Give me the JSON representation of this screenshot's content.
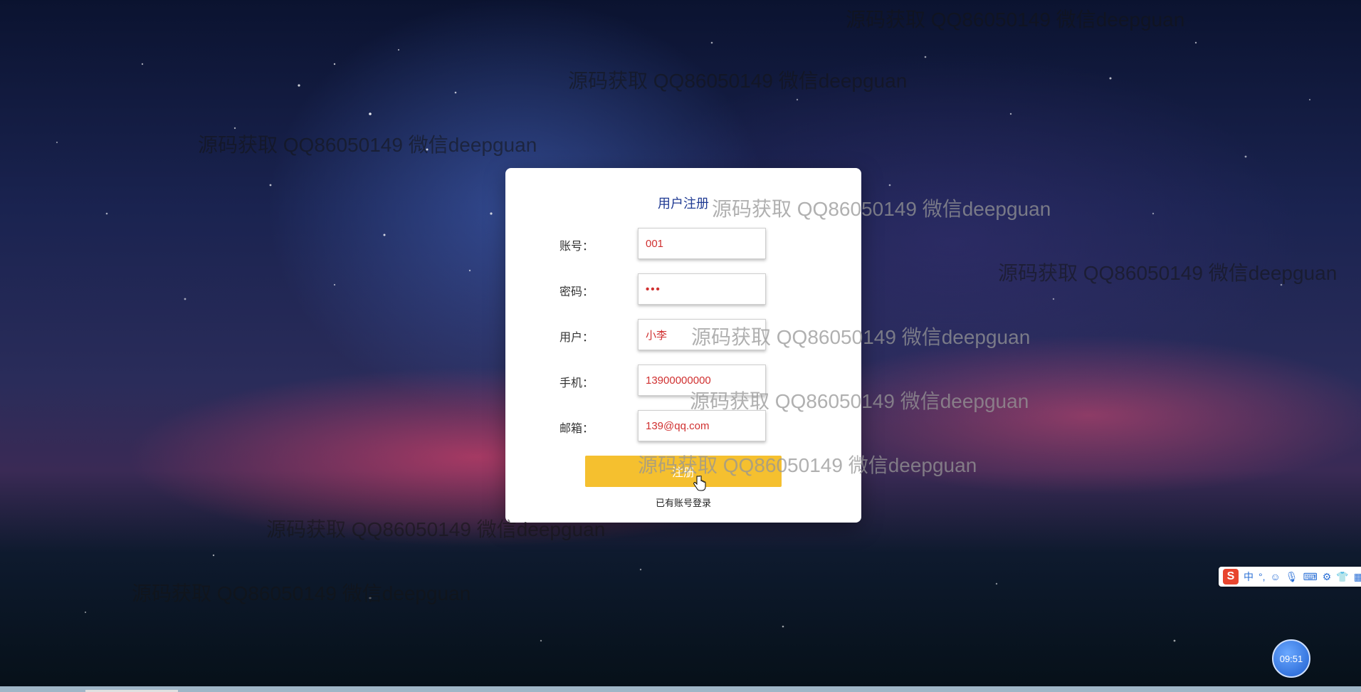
{
  "form": {
    "title": "用户注册",
    "fields": [
      {
        "label": "账号：",
        "value": "001"
      },
      {
        "label": "密码：",
        "value": "•••"
      },
      {
        "label": "用户：",
        "value": "小李"
      },
      {
        "label": "手机：",
        "value": "13900000000"
      },
      {
        "label": "邮箱：",
        "value": "139@qq.com"
      }
    ],
    "submit_label": "注册",
    "login_link": "已有账号登录"
  },
  "watermark": "源码获取 QQ86050149 微信deepguan",
  "ime": {
    "logo": "S",
    "mode": "中",
    "punct": "°,",
    "icons": [
      "smiley-icon",
      "microphone-icon",
      "keyboard-icon",
      "tools-icon",
      "skin-icon",
      "grid-icon"
    ]
  },
  "clock": {
    "time": "09:51"
  },
  "colors": {
    "button": "#f5c02f",
    "title": "#1f3a93",
    "input_text": "#d03030"
  }
}
